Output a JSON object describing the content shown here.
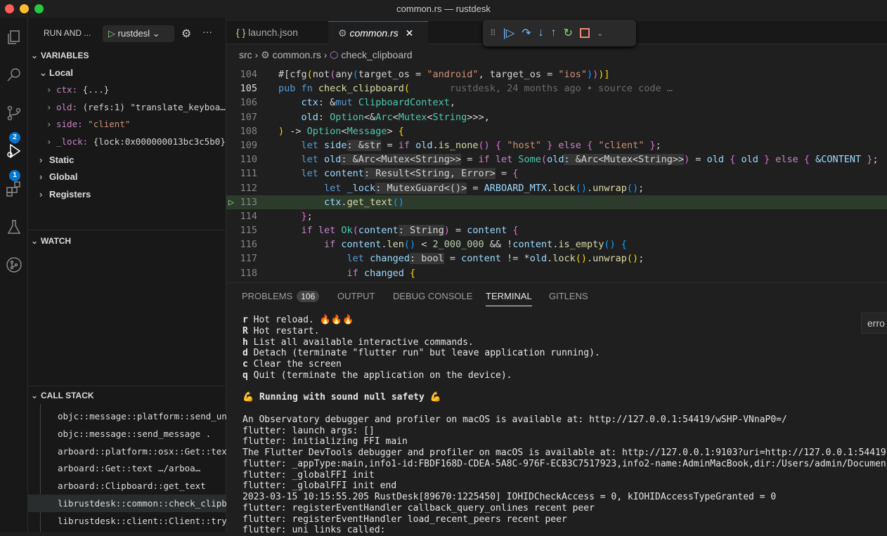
{
  "window": {
    "title": "common.rs — rustdesk"
  },
  "activity": {
    "scm_badge": "2",
    "debug_badge": "1"
  },
  "sidebar": {
    "header": "RUN AND ...",
    "config": "rustdesl",
    "variables_title": "VARIABLES",
    "local": "Local",
    "vars": [
      {
        "name": "ctx",
        "value": "{...}",
        "vcls": "p"
      },
      {
        "name": "old",
        "value": "(refs:1) \"translate_keyboa…",
        "vcls": "p"
      },
      {
        "name": "side",
        "value": "\"client\"",
        "vcls": "str"
      },
      {
        "name": "_lock",
        "value": "{lock:0x000000013bc3c5b0}",
        "vcls": "p"
      }
    ],
    "scopes": [
      "Static",
      "Global",
      "Registers"
    ],
    "watch_title": "WATCH",
    "callstack_title": "CALL STACK",
    "frames": [
      "objc::message::platform::send_unv",
      "objc::message::send_message  .",
      "arboard::platform::osx::Get::text",
      "arboard::Get::text  …/arboa…",
      "arboard::Clipboard::get_text",
      "librustdesk::common::check_clipboard",
      "librustdesk::client::Client::try_"
    ]
  },
  "tabs": [
    {
      "label": "launch.json",
      "icon": "{ }"
    },
    {
      "label": "common.rs",
      "icon": "⚙"
    }
  ],
  "breadcrumb": [
    "src",
    "common.rs",
    "check_clipboard"
  ],
  "code": [
    {
      "n": "104",
      "t": [
        [
          "#[",
          "p"
        ],
        [
          "cfg",
          "p"
        ],
        [
          "(",
          "b1"
        ],
        [
          "not",
          "p"
        ],
        [
          "(",
          "b2"
        ],
        [
          "any",
          "p"
        ],
        [
          "(",
          "b3"
        ],
        [
          "target_os = ",
          "p"
        ],
        [
          "\"android\"",
          "str"
        ],
        [
          ", target_os = ",
          "p"
        ],
        [
          "\"ios\"",
          "str"
        ],
        [
          ")",
          "b3"
        ],
        [
          ")",
          "b2"
        ],
        [
          ")",
          "b1"
        ],
        [
          "]",
          "b1"
        ]
      ]
    },
    {
      "n": "105",
      "t": [
        [
          "pub fn ",
          "kw"
        ],
        [
          "check_clipboard",
          "fn"
        ],
        [
          "(",
          "b1"
        ],
        [
          "       rustdesk, 24 months ago • source code …",
          "blame"
        ]
      ]
    },
    {
      "n": "106",
      "t": [
        [
          "    ",
          "p"
        ],
        [
          "ctx",
          "var"
        ],
        [
          ": &",
          "p"
        ],
        [
          "mut ",
          "kw"
        ],
        [
          "ClipboardContext",
          "ty"
        ],
        [
          ",",
          "p"
        ]
      ]
    },
    {
      "n": "107",
      "t": [
        [
          "    ",
          "p"
        ],
        [
          "old",
          "var"
        ],
        [
          ": ",
          "p"
        ],
        [
          "Option",
          "ty"
        ],
        [
          "<&",
          "p"
        ],
        [
          "Arc",
          "ty"
        ],
        [
          "<",
          "p"
        ],
        [
          "Mutex",
          "ty"
        ],
        [
          "<",
          "p"
        ],
        [
          "String",
          "ty"
        ],
        [
          ">>>,",
          "p"
        ]
      ]
    },
    {
      "n": "108",
      "t": [
        [
          ")",
          "b1"
        ],
        [
          " -> ",
          "p"
        ],
        [
          "Option",
          "ty"
        ],
        [
          "<",
          "p"
        ],
        [
          "Message",
          "ty"
        ],
        [
          "> ",
          "p"
        ],
        [
          "{",
          "b1"
        ]
      ]
    },
    {
      "n": "109",
      "t": [
        [
          "    ",
          "p"
        ],
        [
          "let ",
          "kw"
        ],
        [
          "side",
          "var"
        ],
        [
          ": &str",
          "hint"
        ],
        [
          " = ",
          "p"
        ],
        [
          "if ",
          "ctl"
        ],
        [
          "old",
          "var"
        ],
        [
          ".",
          "p"
        ],
        [
          "is_none",
          "fn"
        ],
        [
          "()",
          "b2"
        ],
        [
          " ",
          "p"
        ],
        [
          "{",
          "b2"
        ],
        [
          " ",
          "p"
        ],
        [
          "\"host\"",
          "str"
        ],
        [
          " ",
          "p"
        ],
        [
          "}",
          "b2"
        ],
        [
          " else ",
          "ctl"
        ],
        [
          "{",
          "b2"
        ],
        [
          " ",
          "p"
        ],
        [
          "\"client\"",
          "str"
        ],
        [
          " ",
          "p"
        ],
        [
          "}",
          "b2"
        ],
        [
          ";",
          "p"
        ]
      ]
    },
    {
      "n": "110",
      "t": [
        [
          "    ",
          "p"
        ],
        [
          "let ",
          "kw"
        ],
        [
          "old",
          "var"
        ],
        [
          ": &Arc<Mutex<String>>",
          "hint"
        ],
        [
          " = ",
          "p"
        ],
        [
          "if let ",
          "ctl"
        ],
        [
          "Some",
          "ty"
        ],
        [
          "(",
          "b2"
        ],
        [
          "old",
          "var"
        ],
        [
          ": &Arc<Mutex<String>>",
          "hint"
        ],
        [
          ")",
          "b2"
        ],
        [
          " = ",
          "p"
        ],
        [
          "old",
          "var"
        ],
        [
          " { ",
          "b2"
        ],
        [
          "old",
          "var"
        ],
        [
          " } ",
          "b2"
        ],
        [
          "else ",
          "ctl"
        ],
        [
          "{ ",
          "b2"
        ],
        [
          "&CONTENT",
          "var"
        ],
        [
          " }",
          "b2"
        ],
        [
          ";",
          "p"
        ]
      ]
    },
    {
      "n": "111",
      "t": [
        [
          "    ",
          "p"
        ],
        [
          "let ",
          "kw"
        ],
        [
          "content",
          "var"
        ],
        [
          ": Result<String, Error>",
          "hint"
        ],
        [
          " = ",
          "p"
        ],
        [
          "{",
          "b2"
        ]
      ]
    },
    {
      "n": "112",
      "t": [
        [
          "        ",
          "p"
        ],
        [
          "let ",
          "kw"
        ],
        [
          "_lock",
          "var"
        ],
        [
          ": MutexGuard<()>",
          "hint"
        ],
        [
          " = ",
          "p"
        ],
        [
          "ARBOARD_MTX",
          "var"
        ],
        [
          ".",
          "p"
        ],
        [
          "lock",
          "fn"
        ],
        [
          "()",
          "b3"
        ],
        [
          ".",
          "p"
        ],
        [
          "unwrap",
          "fn"
        ],
        [
          "()",
          "b3"
        ],
        [
          ";",
          "p"
        ]
      ]
    },
    {
      "n": "113",
      "t": [
        [
          "        ",
          "p"
        ],
        [
          "ctx",
          "var"
        ],
        [
          ".",
          "p"
        ],
        [
          "get_text",
          "fn"
        ],
        [
          "()",
          "b3"
        ]
      ]
    },
    {
      "n": "114",
      "t": [
        [
          "    ",
          "p"
        ],
        [
          "}",
          "b2"
        ],
        [
          ";",
          "p"
        ]
      ]
    },
    {
      "n": "115",
      "t": [
        [
          "    ",
          "p"
        ],
        [
          "if let ",
          "ctl"
        ],
        [
          "Ok",
          "ty"
        ],
        [
          "(",
          "b2"
        ],
        [
          "content",
          "var"
        ],
        [
          ": String",
          "hint"
        ],
        [
          ")",
          "b2"
        ],
        [
          " = ",
          "p"
        ],
        [
          "content",
          "var"
        ],
        [
          " ",
          "p"
        ],
        [
          "{",
          "b2"
        ]
      ]
    },
    {
      "n": "116",
      "t": [
        [
          "        ",
          "p"
        ],
        [
          "if ",
          "ctl"
        ],
        [
          "content",
          "var"
        ],
        [
          ".",
          "p"
        ],
        [
          "len",
          "fn"
        ],
        [
          "()",
          "b3"
        ],
        [
          " < ",
          "p"
        ],
        [
          "2_000_000",
          "num"
        ],
        [
          " && !",
          "p"
        ],
        [
          "content",
          "var"
        ],
        [
          ".",
          "p"
        ],
        [
          "is_empty",
          "fn"
        ],
        [
          "()",
          "b3"
        ],
        [
          " ",
          "p"
        ],
        [
          "{",
          "b3"
        ]
      ]
    },
    {
      "n": "117",
      "t": [
        [
          "            ",
          "p"
        ],
        [
          "let ",
          "kw"
        ],
        [
          "changed",
          "var"
        ],
        [
          ": bool",
          "hint"
        ],
        [
          " = ",
          "p"
        ],
        [
          "content",
          "var"
        ],
        [
          " != *",
          "p"
        ],
        [
          "old",
          "var"
        ],
        [
          ".",
          "p"
        ],
        [
          "lock",
          "fn"
        ],
        [
          "()",
          "b1"
        ],
        [
          ".",
          "p"
        ],
        [
          "unwrap",
          "fn"
        ],
        [
          "()",
          "b1"
        ],
        [
          ";",
          "p"
        ]
      ]
    },
    {
      "n": "118",
      "t": [
        [
          "            ",
          "p"
        ],
        [
          "if ",
          "ctl"
        ],
        [
          "changed",
          "var"
        ],
        [
          " ",
          "p"
        ],
        [
          "{",
          "b1"
        ]
      ]
    }
  ],
  "panel": {
    "tabs": [
      "PROBLEMS",
      "OUTPUT",
      "DEBUG CONSOLE",
      "TERMINAL",
      "GITLENS"
    ],
    "problems_count": "106",
    "terminal": [
      [
        "r",
        " Hot reload. 🔥🔥🔥"
      ],
      [
        "R",
        " Hot restart."
      ],
      [
        "h",
        " List all available interactive commands."
      ],
      [
        "d",
        " Detach (terminate \"flutter run\" but leave application running)."
      ],
      [
        "c",
        " Clear the screen"
      ],
      [
        "q",
        " Quit (terminate the application on the device)."
      ],
      [
        "",
        ""
      ],
      [
        "💪 Running with sound null safety 💪",
        ""
      ],
      [
        "",
        ""
      ],
      [
        "",
        "An Observatory debugger and profiler on macOS is available at: http://127.0.0.1:54419/wSHP-VNnaP0=/"
      ],
      [
        "",
        "flutter: launch args: []"
      ],
      [
        "",
        "flutter: initializing FFI main"
      ],
      [
        "",
        "The Flutter DevTools debugger and profiler on macOS is available at: http://127.0.0.1:9103?uri=http://127.0.0.1:54419"
      ],
      [
        "",
        "flutter: _appType:main,info1-id:FBDF168D-CDEA-5A8C-976F-ECB3C7517923,info2-name:AdminMacBook,dir:/Users/admin/Documen"
      ],
      [
        "",
        "flutter: _globalFFI init"
      ],
      [
        "",
        "flutter: _globalFFI init end"
      ],
      [
        "",
        "2023-03-15 10:15:55.205 RustDesk[89670:1225450] IOHIDCheckAccess = 0, kIOHIDAccessTypeGranted = 0"
      ],
      [
        "",
        "flutter: registerEventHandler callback_query_onlines recent peer"
      ],
      [
        "",
        "flutter: registerEventHandler load_recent_peers recent peer"
      ],
      [
        "",
        "flutter: uni links called:"
      ]
    ],
    "hover": "erro"
  }
}
